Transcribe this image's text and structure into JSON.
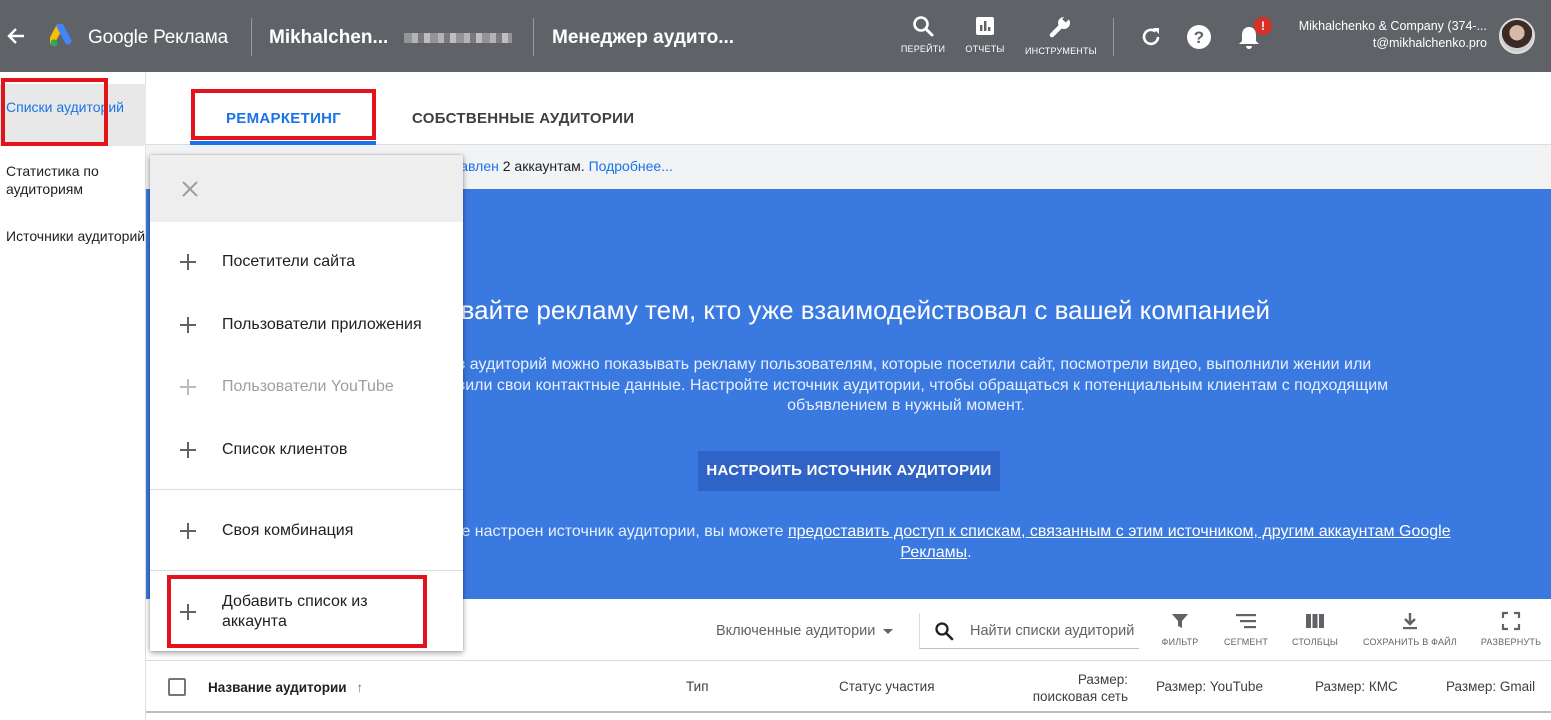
{
  "topbar": {
    "brand": "Google Реклама",
    "account_name": "Mikhalchen...",
    "page_title": "Менеджер аудито...",
    "tools": [
      {
        "icon": "search-icon",
        "label": "ПЕРЕЙТИ"
      },
      {
        "icon": "reports-icon",
        "label": "ОТЧЕТЫ"
      },
      {
        "icon": "wrench-icon",
        "label": "ИНСТРУМЕНТЫ"
      }
    ],
    "notification_badge": "!",
    "account_line1": "Mikhalchenko & Company (374-...",
    "account_line2": "t@mikhalchenko.pro"
  },
  "sidebar": {
    "items": [
      {
        "label": "Списки аудиторий",
        "active": true
      },
      {
        "label": "Статистика по аудиториям"
      },
      {
        "label": "Источники аудиторий"
      }
    ]
  },
  "tabs": [
    {
      "label": "РЕМАРКЕТИНГ",
      "active": true
    },
    {
      "label": "СОБСТВЕННЫЕ АУДИТОРИИ"
    }
  ],
  "info_bar": {
    "visible_part": "тавлен",
    "text": " 2 аккаунтам. ",
    "link": "Подробнее..."
  },
  "hero": {
    "title": "ывайте рекламу тем, кто уже взаимодействовал с вашей компанией",
    "description": "ков аудиторий можно показывать рекламу пользователям, которые посетили сайт, посмотрели видео, выполнили жении или оставили свои контактные данные. Настройте источник аудитории, чтобы обращаться к потенциальным клиентам с подходящим объявлением в нужный момент.",
    "button": "НАСТРОИТЬ ИСТОЧНИК АУДИТОРИИ",
    "footer_text": "каунте настроен источник аудитории, вы можете ",
    "footer_link": "предоставить доступ к спискам, связанным с этим источником, другим аккаунтам Google Рекламы",
    "footer_end": "."
  },
  "toolbar": {
    "filter_dropdown": "Включенные аудитории",
    "search_placeholder": "Найти списки аудиторий",
    "buttons": [
      {
        "icon": "filter-icon",
        "label": "ФИЛЬТР"
      },
      {
        "icon": "segment-icon",
        "label": "СЕГМЕНТ"
      },
      {
        "icon": "columns-icon",
        "label": "СТОЛБЦЫ"
      },
      {
        "icon": "download-icon",
        "label": "СОХРАНИТЬ В ФАЙЛ"
      },
      {
        "icon": "expand-icon",
        "label": "РАЗВЕРНУТЬ"
      }
    ]
  },
  "table": {
    "columns": [
      "Название аудитории",
      "Тип",
      "Статус участия",
      "Размер: поисковая сеть",
      "Размер: YouTube",
      "Размер: КМС",
      "Размер: Gmail"
    ],
    "size_search_line1": "Размер:",
    "size_search_line2": "поисковая сеть"
  },
  "menu": {
    "items": [
      {
        "label": "Посетители сайта",
        "enabled": true
      },
      {
        "label": "Пользователи приложения",
        "enabled": true
      },
      {
        "label": "Пользователи YouTube",
        "enabled": false
      },
      {
        "label": "Список клиентов",
        "enabled": true
      },
      {
        "label": "Своя комбинация",
        "enabled": true
      },
      {
        "label_line1": "Добавить список из",
        "label_line2": "аккаунта",
        "enabled": true
      }
    ]
  },
  "colors": {
    "topbar": "#5f6368",
    "accent": "#1a73e8",
    "hero": "#3a79e0",
    "annotation": "#e3131b"
  }
}
